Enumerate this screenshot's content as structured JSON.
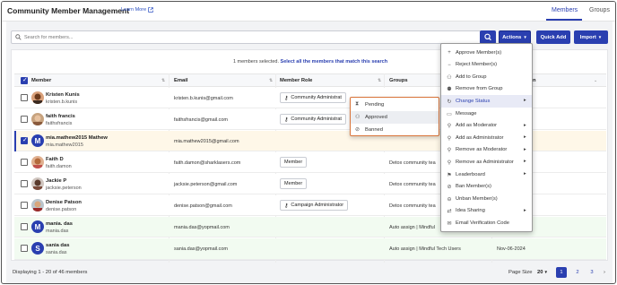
{
  "app": {
    "title": "Community Member Management",
    "learn_more": "Learn More"
  },
  "tabs": [
    {
      "label": "Members",
      "active": true
    },
    {
      "label": "Groups",
      "active": false
    }
  ],
  "search": {
    "placeholder": "Search for members..."
  },
  "toolbar": {
    "actions_label": "Actions",
    "quick_add_label": "Quick Add",
    "import_label": "Import"
  },
  "selection": {
    "message": "1 members selected.",
    "select_all_link": "Select all the members that match this search"
  },
  "table": {
    "columns": {
      "member": "Member",
      "email": "Email",
      "role": "Member Role",
      "groups": "Groups",
      "last_col_fragment": "n"
    },
    "rows": [
      {
        "name": "Kristen Kunis",
        "username": "kristen.b.kunis",
        "email": "kristen.b.kunis@gmail.com",
        "role": "Community Administrat",
        "role_icon": "key-icon",
        "groups": "",
        "date": "",
        "checked": false
      },
      {
        "name": "faith francis",
        "username": "faithsfrancis",
        "email": "faithsfrancis@gmail.com",
        "role": "Community Administrat",
        "role_icon": "key-icon",
        "groups": "",
        "date": "",
        "checked": false
      },
      {
        "name": "mia.mathew2015 Mathew",
        "username": "mia.mathew2015",
        "email": "mia.mathew2015@gmail.com",
        "role": "",
        "role_icon": "",
        "groups": "",
        "date": "",
        "checked": true,
        "avatar_letter": "M"
      },
      {
        "name": "Faith D",
        "username": "faith.damon",
        "email": "faith.damon@sharklasers.com",
        "role": "Member",
        "role_icon": "",
        "groups": "Detox community tea",
        "date": "",
        "checked": false
      },
      {
        "name": "Jackie P",
        "username": "jacksie.peterson",
        "email": "jacksie.peterson@gmail.com",
        "role": "Member",
        "role_icon": "",
        "groups": "Detox community tea",
        "date": "",
        "checked": false
      },
      {
        "name": "Denise Patson",
        "username": "denise.patson",
        "email": "denise.patson@gmail.com",
        "role": "Campaign Administrator",
        "role_icon": "key-icon",
        "groups": "Detox community tea",
        "date": "",
        "checked": false
      },
      {
        "name": "mania. das",
        "username": "mania.das",
        "email": "mania.das@yopmail.com",
        "role": "",
        "role_icon": "",
        "groups": "Auto assign | Mindful",
        "date": "",
        "checked": false,
        "avatar_letter": "M"
      },
      {
        "name": "sania das",
        "username": "sania.das",
        "email": "sania.das@yopmail.com",
        "role": "",
        "role_icon": "",
        "groups": "Auto assign | Mindful Tech Users",
        "date": "Nov-06-2024",
        "checked": false,
        "avatar_letter": "S"
      }
    ]
  },
  "footer": {
    "displaying": "Displaying 1 - 20 of 46 members",
    "page_size_label": "Page Size",
    "page_size_value": "20",
    "pages": [
      "1",
      "2",
      "3"
    ],
    "current_page": "1"
  },
  "actions_menu": [
    {
      "label": "Approve Member(s)",
      "icon": "plus-icon",
      "submenu": false
    },
    {
      "label": "Reject Member(s)",
      "icon": "minus-icon",
      "submenu": false
    },
    {
      "label": "Add to Group",
      "icon": "group-add-icon",
      "submenu": false
    },
    {
      "label": "Remove from Group",
      "icon": "group-remove-icon",
      "submenu": false
    },
    {
      "label": "Change Status",
      "icon": "refresh-icon",
      "submenu": true,
      "active": true
    },
    {
      "label": "Message",
      "icon": "message-icon",
      "submenu": false
    },
    {
      "label": "Add as Moderator",
      "icon": "moderator-add-icon",
      "submenu": true
    },
    {
      "label": "Add as Administrator",
      "icon": "admin-add-icon",
      "submenu": true
    },
    {
      "label": "Remove as Moderator",
      "icon": "moderator-remove-icon",
      "submenu": true
    },
    {
      "label": "Remove as Administrator",
      "icon": "admin-remove-icon",
      "submenu": true
    },
    {
      "label": "Leaderboard",
      "icon": "leaderboard-icon",
      "submenu": true
    },
    {
      "label": "Ban Member(s)",
      "icon": "ban-icon",
      "submenu": false
    },
    {
      "label": "Unban Member(s)",
      "icon": "unban-icon",
      "submenu": false
    },
    {
      "label": "Idea Sharing",
      "icon": "share-icon",
      "submenu": true
    },
    {
      "label": "Email Verification Code",
      "icon": "email-icon",
      "submenu": false
    }
  ],
  "status_submenu": [
    {
      "label": "Pending",
      "icon": "hourglass-icon"
    },
    {
      "label": "Approved",
      "icon": "approved-icon",
      "active": true
    },
    {
      "label": "Banned",
      "icon": "banned-icon"
    }
  ],
  "colors": {
    "accent": "#2a3fb0",
    "highlight_row": "#fef7e8",
    "green_row": "#f2fbf1",
    "submenu_border": "#d9743a"
  }
}
